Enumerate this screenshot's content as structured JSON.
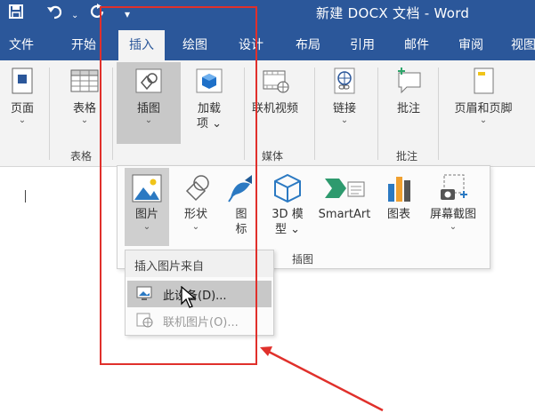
{
  "window": {
    "title": "新建 DOCX 文档  -  Word"
  },
  "quick_access": {
    "save_icon": "save-icon",
    "undo_icon": "undo-icon",
    "redo_icon": "redo-icon",
    "customize_icon": "chevron-down-icon"
  },
  "tabs": [
    "文件",
    "开始",
    "插入",
    "绘图",
    "设计",
    "布局",
    "引用",
    "邮件",
    "审阅",
    "视图"
  ],
  "active_tab": "插入",
  "ribbon": {
    "pages": "页面",
    "table": "表格",
    "illustrations": "插图",
    "addins_line1": "加载",
    "addins_line2": "项",
    "online_video": "联机视频",
    "links": "链接",
    "comment": "批注",
    "header_footer": "页眉和页脚",
    "groups": {
      "table": "表格",
      "media": "媒体",
      "comments": "批注"
    }
  },
  "illustrations_menu": {
    "pictures": "图片",
    "shapes": "形状",
    "icons_line1": "图",
    "icons_line2": "标",
    "model3d_line1": "3D 模",
    "model3d_line2": "型",
    "smartart": "SmartArt",
    "chart": "图表",
    "screenshot": "屏幕截图",
    "group_label": "插图"
  },
  "picture_source_menu": {
    "header": "插入图片来自",
    "this_device": "此设备(D)...",
    "online_pictures": "联机图片(O)..."
  },
  "colors": {
    "word_blue": "#2b579a",
    "annotation_red": "#e0302b"
  }
}
